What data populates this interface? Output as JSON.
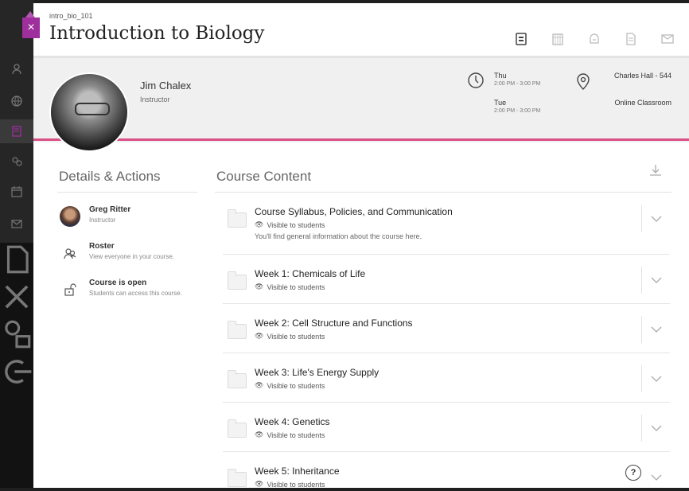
{
  "header": {
    "course_id": "intro_bio_101",
    "title": "Introduction to Biology",
    "close_label": "×",
    "icons": [
      "content-icon",
      "calendar-icon",
      "discussions-icon",
      "gradebook-icon",
      "messages-icon"
    ]
  },
  "instructor": {
    "name": "Jim Chalex",
    "role": "Instructor"
  },
  "schedule": [
    {
      "day": "Thu",
      "time": "2:00 PM - 3:00 PM"
    },
    {
      "day": "Tue",
      "time": "2:00 PM - 3:00 PM"
    }
  ],
  "locations": [
    "Charles Hall - 544",
    "Online Classroom"
  ],
  "details": {
    "title": "Details & Actions",
    "items": [
      {
        "title": "Greg Ritter",
        "subtitle": "Instructor"
      },
      {
        "title": "Roster",
        "subtitle": "View everyone in your course."
      },
      {
        "title": "Course is open",
        "subtitle": "Students can access this course."
      }
    ]
  },
  "content": {
    "title": "Course Content",
    "items": [
      {
        "title": "Course Syllabus, Policies, and Communication",
        "visibility": "Visible to students",
        "description": "You'll find general information about the course here."
      },
      {
        "title": "Week 1: Chemicals of Life",
        "visibility": "Visible to students"
      },
      {
        "title": "Week 2: Cell Structure and Functions",
        "visibility": "Visible to students"
      },
      {
        "title": "Week 3: Life's Energy Supply",
        "visibility": "Visible to students"
      },
      {
        "title": "Week 4: Genetics",
        "visibility": "Visible to students"
      },
      {
        "title": "Week 5: Inheritance",
        "visibility": "Visible to students"
      }
    ]
  },
  "help_label": "?",
  "colors": {
    "accent_purple": "#9e2f9c",
    "accent_pink": "#d94f86"
  }
}
